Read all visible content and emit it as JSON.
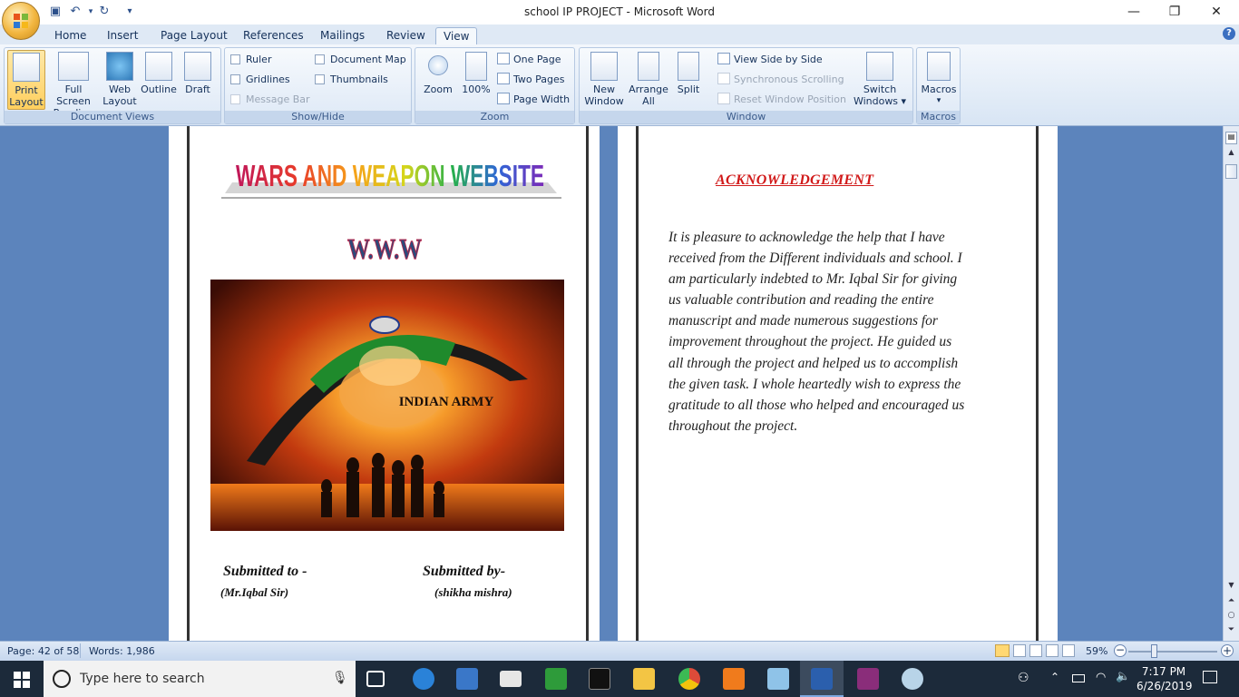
{
  "window": {
    "title": "school IP PROJECT - Microsoft Word",
    "controls": {
      "minimize": "—",
      "restore": "❐",
      "close": "✕"
    }
  },
  "qat": {
    "save_icon": "save-icon",
    "undo_icon": "undo-icon",
    "redo_icon": "redo-icon",
    "customize_icon": "customize-icon"
  },
  "tabs": [
    "Home",
    "Insert",
    "Page Layout",
    "References",
    "Mailings",
    "Review",
    "View"
  ],
  "active_tab": "View",
  "ribbon": {
    "document_views": {
      "label": "Document Views",
      "buttons": [
        {
          "l1": "Print",
          "l2": "Layout"
        },
        {
          "l1": "Full Screen",
          "l2": "Reading"
        },
        {
          "l1": "Web",
          "l2": "Layout"
        },
        {
          "l1": "Outline",
          "l2": ""
        },
        {
          "l1": "Draft",
          "l2": ""
        }
      ]
    },
    "show_hide": {
      "label": "Show/Hide",
      "ruler": "Ruler",
      "gridlines": "Gridlines",
      "message_bar": "Message Bar",
      "document_map": "Document Map",
      "thumbnails": "Thumbnails"
    },
    "zoom": {
      "label": "Zoom",
      "zoom_btn": "Zoom",
      "pct_btn": "100%",
      "one_page": "One Page",
      "two_pages": "Two Pages",
      "page_width": "Page Width"
    },
    "window": {
      "label": "Window",
      "new_window": {
        "l1": "New",
        "l2": "Window"
      },
      "arrange_all": {
        "l1": "Arrange",
        "l2": "All"
      },
      "split": "Split",
      "view_side": "View Side by Side",
      "sync_scroll": "Synchronous Scrolling",
      "reset_pos": "Reset Window Position",
      "switch": {
        "l1": "Switch",
        "l2": "Windows ▾"
      }
    },
    "macros": {
      "label": "Macros",
      "btn": "Macros",
      "arrow": "▾"
    }
  },
  "left_page": {
    "heading": "WARS AND WEAPON WEBSITE",
    "www": "W.W.W",
    "image_caption": "INDIAN ARMY",
    "submitted_to": "Submitted  to -",
    "submitted_by": "Submitted  by-",
    "to_name": "(Mr.Iqbal Sir)",
    "by_name": "(shikha mishra)"
  },
  "right_page": {
    "heading": "ACKNOWLEDGEMENT",
    "lines": [
      "It is pleasure to acknowledge the help that I have",
      "received from the Different individuals and school. I",
      "am particularly indebted to Mr. Iqbal Sir for giving",
      "us valuable contribution and reading the entire",
      "manuscript and made numerous suggestions for",
      "improvement throughout the project. He guided us",
      "all through the project and helped us to accomplish",
      "the given task. I whole heartedly wish to express the",
      "gratitude to all those who helped and encouraged us",
      "throughout the project."
    ]
  },
  "status": {
    "page": "Page: 42 of 58",
    "words": "Words: 1,986",
    "zoom": "59%"
  },
  "taskbar": {
    "search_placeholder": "Type here to search",
    "time": "7:17 PM",
    "date": "6/26/2019"
  },
  "colors": {
    "ack_heading": "#d11a1a",
    "ribbon_label_bg": "#c5d6ec",
    "doc_bg": "#5c84bc"
  }
}
